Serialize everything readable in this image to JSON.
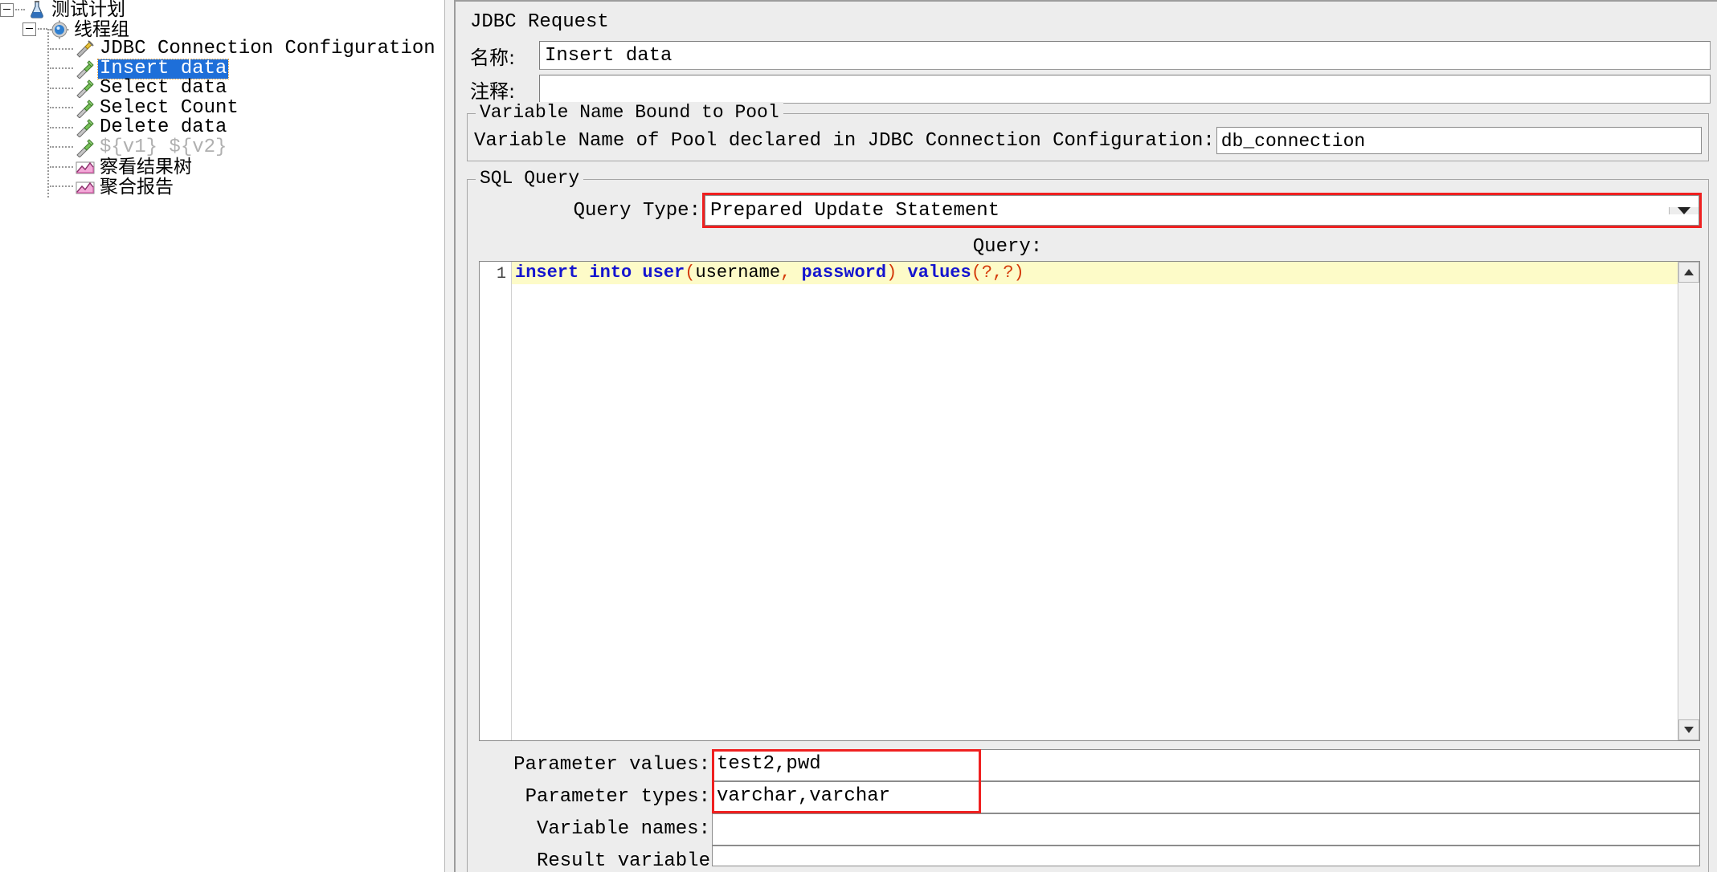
{
  "tree": {
    "nodes": [
      {
        "label": "测试计划",
        "icon": "test-plan-icon",
        "depth": 0,
        "state": "normal",
        "expander": "collapse"
      },
      {
        "label": "线程组",
        "icon": "thread-group-icon",
        "depth": 1,
        "state": "normal",
        "expander": "collapse"
      },
      {
        "label": "JDBC Connection Configuration",
        "icon": "config-element-icon",
        "depth": 2,
        "state": "normal",
        "expander": "none"
      },
      {
        "label": "Insert data",
        "icon": "jdbc-request-icon",
        "depth": 2,
        "state": "selected",
        "expander": "none"
      },
      {
        "label": "Select data",
        "icon": "jdbc-request-icon",
        "depth": 2,
        "state": "normal",
        "expander": "none"
      },
      {
        "label": "Select Count",
        "icon": "jdbc-request-icon",
        "depth": 2,
        "state": "normal",
        "expander": "none"
      },
      {
        "label": "Delete data",
        "icon": "jdbc-request-icon",
        "depth": 2,
        "state": "normal",
        "expander": "none"
      },
      {
        "label": "${v1} ${v2}",
        "icon": "jdbc-request-icon",
        "depth": 2,
        "state": "disabled",
        "expander": "none"
      },
      {
        "label": "察看结果树",
        "icon": "view-results-tree-icon",
        "depth": 2,
        "state": "normal",
        "expander": "none"
      },
      {
        "label": "聚合报告",
        "icon": "aggregate-report-icon",
        "depth": 2,
        "state": "normal",
        "expander": "none"
      }
    ]
  },
  "panel": {
    "title": "JDBC Request",
    "name_label": "名称:",
    "name_value": "Insert data",
    "comments_label": "注释:",
    "comments_value": ""
  },
  "pool_group": {
    "title": "Variable Name Bound to Pool",
    "label": "Variable Name of Pool declared in JDBC Connection Configuration:",
    "value": "db_connection"
  },
  "sql_group": {
    "title": "SQL Query",
    "query_type_label": "Query Type:",
    "query_type_value": "Prepared Update Statement",
    "query_caption": "Query:",
    "line_number": "1",
    "sql_tokens": [
      {
        "t": "insert into user",
        "k": "kw"
      },
      {
        "t": "(",
        "k": "pn"
      },
      {
        "t": "username",
        "k": "id"
      },
      {
        "t": ",",
        "k": "pn"
      },
      {
        "t": " ",
        "k": "id"
      },
      {
        "t": "password",
        "k": "kw"
      },
      {
        "t": ")",
        "k": "pn"
      },
      {
        "t": " ",
        "k": "id"
      },
      {
        "t": "values",
        "k": "kw"
      },
      {
        "t": "(?,?)",
        "k": "pn"
      }
    ],
    "sql_plain": "insert into user(username, password) values(?,?)"
  },
  "params": [
    {
      "label": "Parameter values:",
      "value": "test2,pwd",
      "highlighted": true
    },
    {
      "label": "Parameter types:",
      "value": "varchar,varchar",
      "highlighted": true
    },
    {
      "label": "Variable names:",
      "value": "",
      "highlighted": false
    },
    {
      "label": "Result variable",
      "value": "",
      "highlighted": false
    }
  ],
  "colors": {
    "highlight_red": "#ef2020",
    "selection_blue": "#1e6fd9",
    "code_keyword": "#1414cf",
    "code_paren": "#d43a0a",
    "code_background": "#fdfbc8",
    "panel_background": "#ededed"
  },
  "scrollbar": {
    "up_arrow": "scroll-up-icon",
    "down_arrow": "scroll-down-icon"
  }
}
